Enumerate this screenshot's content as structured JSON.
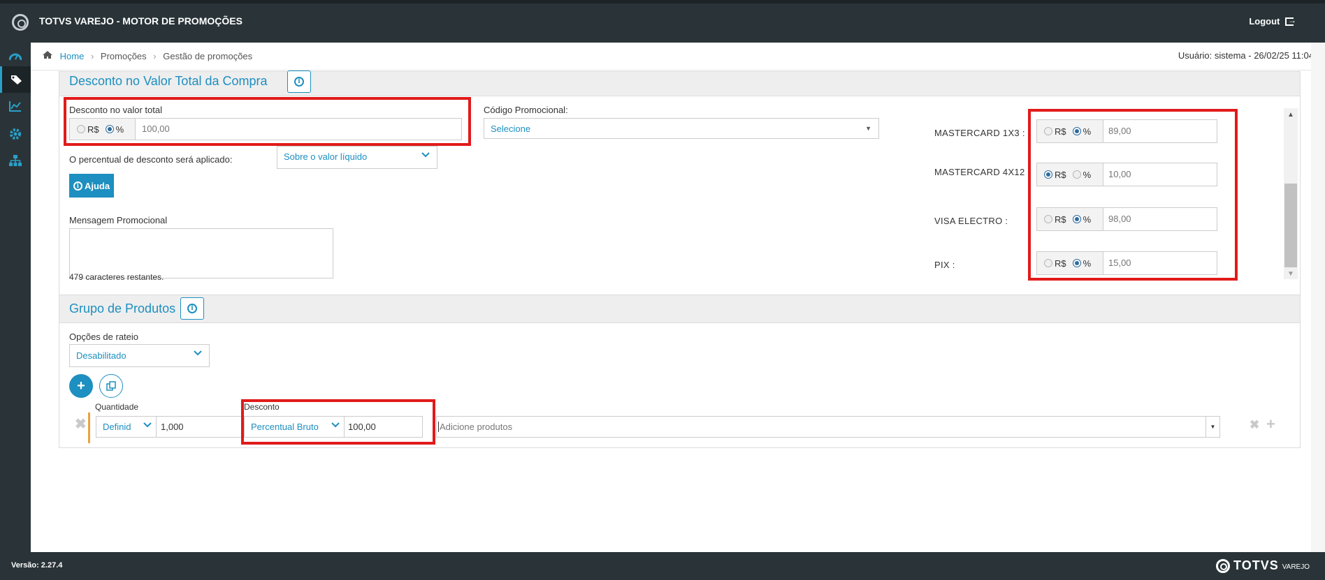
{
  "app": {
    "title": "TOTVS VAREJO - MOTOR DE PROMOÇÕES",
    "logout_label": "Logout"
  },
  "sidebar": {
    "items": [
      {
        "icon": "dashboard-icon",
        "active": false
      },
      {
        "icon": "tags-icon",
        "active": true
      },
      {
        "icon": "chart-line-icon",
        "active": false
      },
      {
        "icon": "gear-icon",
        "active": false
      },
      {
        "icon": "sitemap-icon",
        "active": false
      }
    ]
  },
  "breadcrumb": {
    "home": "Home",
    "level2": "Promoções",
    "level3": "Gestão de promoções"
  },
  "user_info": "Usuário: sistema - 26/02/25 11:04",
  "desconto_panel": {
    "title": "Desconto no Valor Total da Compra",
    "desconto_label": "Desconto no valor total",
    "radio_rs": "R$",
    "radio_pct": "%",
    "selected_type": "%",
    "value": "100,00",
    "codigo_label": "Código Promocional:",
    "codigo_value": "Selecione",
    "percentual_label": "O percentual de desconto será aplicado:",
    "percentual_value": "Sobre o valor líquido",
    "help_label": "Ajuda",
    "mensagem_label": "Mensagem Promocional",
    "mensagem_value": "",
    "chars_remaining": "479 caracteres restantes.",
    "payments": [
      {
        "label": "MASTERCARD 1X3 :",
        "selected": "%",
        "value": "89,00"
      },
      {
        "label": "MASTERCARD 4X12 :",
        "selected": "R$",
        "value": "10,00"
      },
      {
        "label": "VISA ELECTRO :",
        "selected": "%",
        "value": "98,00"
      },
      {
        "label": "PIX :",
        "selected": "%",
        "value": "15,00"
      }
    ]
  },
  "grupo_panel": {
    "title": "Grupo de Produtos",
    "rateio_label": "Opções de rateio",
    "rateio_value": "Desabilitado",
    "quantidade_label": "Quantidade",
    "quantidade_mode": "Definid",
    "quantidade_value": "1,000",
    "desconto_label": "Desconto",
    "desconto_type": "Percentual Bruto",
    "desconto_value": "100,00",
    "produtos_placeholder": "Adicione produtos"
  },
  "footer": {
    "version": "Versão: 2.27.4",
    "brand": "TOTVS",
    "brand_sub": "VAREJO"
  },
  "colors": {
    "accent": "#1d8fc0",
    "highlight": "#e11b1b",
    "chrome": "#2a3438"
  }
}
